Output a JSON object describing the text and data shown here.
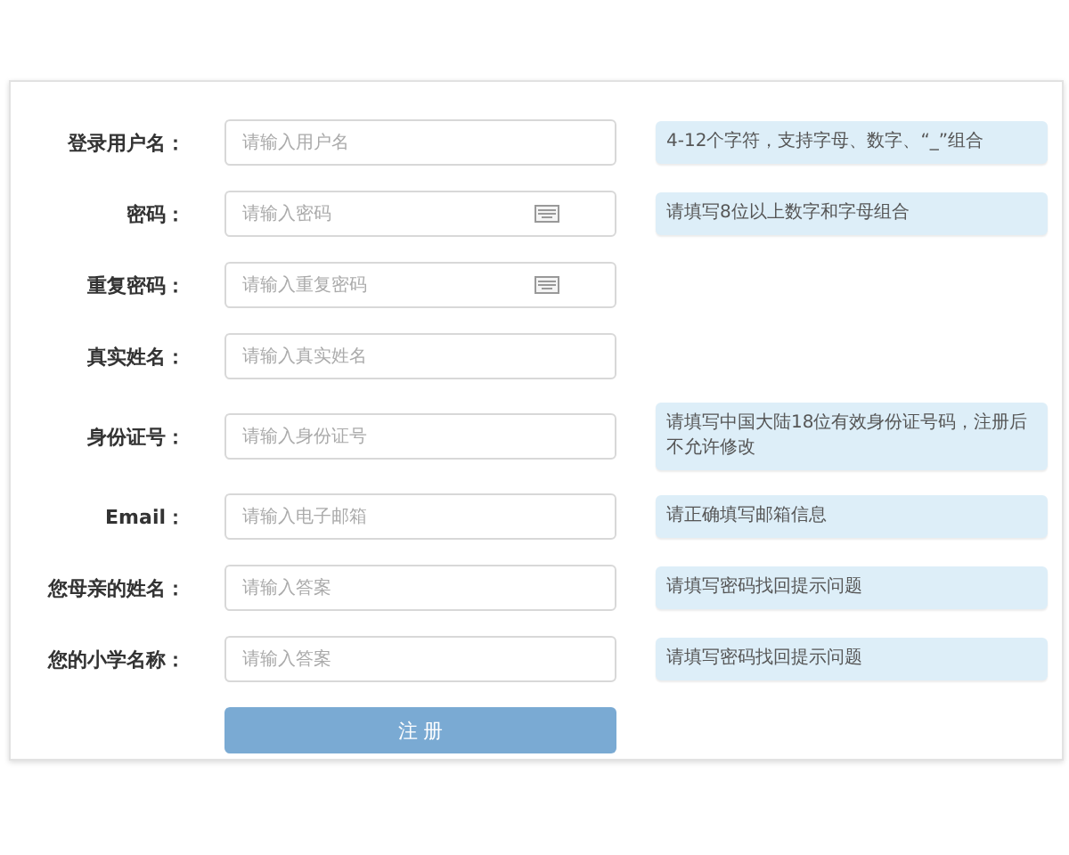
{
  "fields": [
    {
      "label": "登录用户名：",
      "kind": "text",
      "placeholder": "请输入用户名",
      "hint": "4-12个字符，支持字母、数字、“_”组合"
    },
    {
      "label": "密码：",
      "kind": "password",
      "placeholder": "请输入密码",
      "hint": "请填写8位以上数字和字母组合"
    },
    {
      "label": "重复密码：",
      "kind": "password",
      "placeholder": "请输入重复密码"
    },
    {
      "label": "真实姓名：",
      "kind": "text",
      "placeholder": "请输入真实姓名"
    },
    {
      "label": "身份证号：",
      "kind": "text",
      "placeholder": "请输入身份证号",
      "hint": "请填写中国大陆18位有效身份证号码，注册后不允许修改"
    },
    {
      "label": "Email：",
      "kind": "text",
      "placeholder": "请输入电子邮箱",
      "hint": "请正确填写邮箱信息"
    },
    {
      "label": "您母亲的姓名：",
      "kind": "text",
      "placeholder": "请输入答案",
      "hint": "请填写密码找回提示问题"
    },
    {
      "label": "您的小学名称：",
      "kind": "text",
      "placeholder": "请输入答案",
      "hint": "请填写密码找回提示问题"
    }
  ],
  "submit": {
    "label": "注 册"
  }
}
